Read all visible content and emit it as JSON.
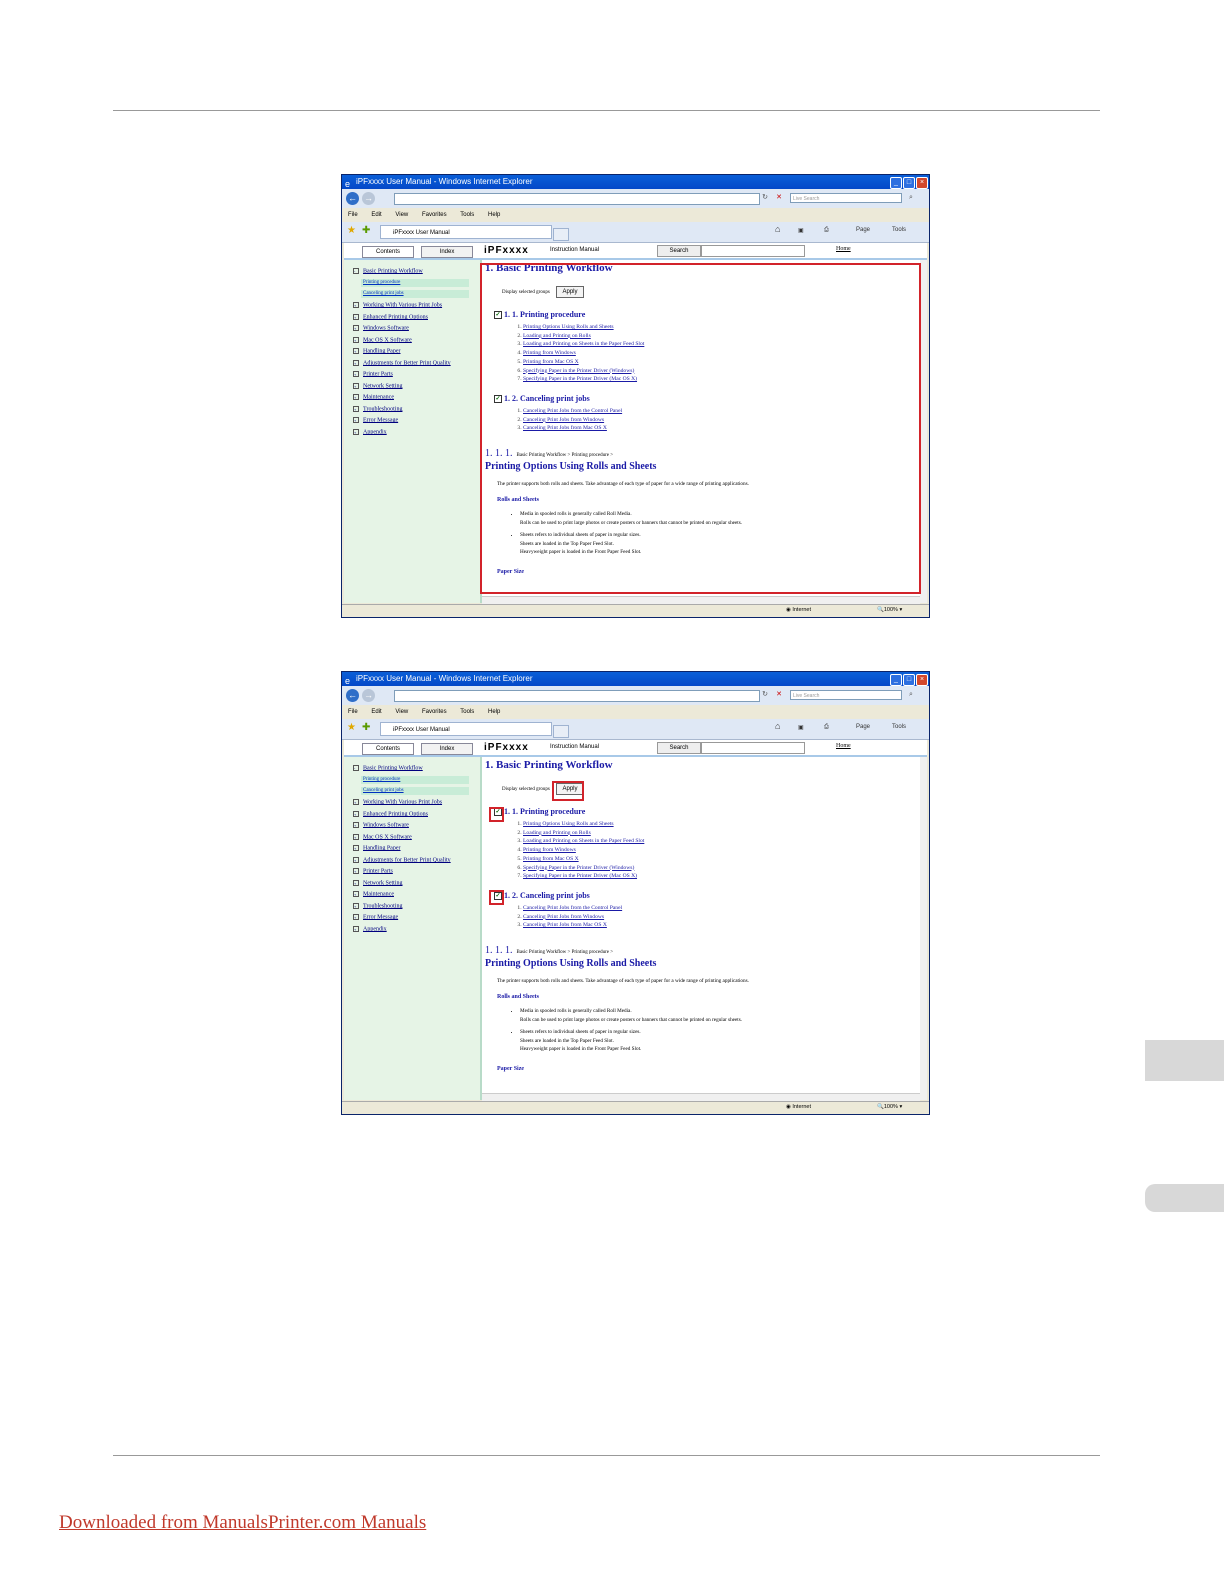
{
  "footer": {
    "link_text": "Downloaded from ManualsPrinter.com Manuals"
  },
  "screenshots": [
    {
      "window_title": "iPFxxxx User Manual - Windows Internet Explorer",
      "search_placeholder": "Live Search",
      "menu": [
        "File",
        "Edit",
        "View",
        "Favorites",
        "Tools",
        "Help"
      ],
      "tab_title": "iPFxxxx User Manual",
      "commands": {
        "page": "Page",
        "tools": "Tools"
      },
      "nav": {
        "contents": "Contents",
        "index": "Index",
        "brand": "iPFxxxx",
        "manual": "Instruction Manual",
        "search": "Search",
        "home": "Home"
      },
      "sidebar": {
        "items": [
          "Basic Printing Workflow",
          "Working With Various Print Jobs",
          "Enhanced Printing Options",
          "Windows Software",
          "Mac OS X Software",
          "Handling Paper",
          "Adjustments for Better Print Quality",
          "Printer Parts",
          "Network Setting",
          "Maintenance",
          "Troubleshooting",
          "Error Message",
          "Appendix"
        ],
        "subitems": [
          "Printing procedure",
          "Canceling print jobs"
        ]
      },
      "main": {
        "title": "1. Basic Printing Workflow",
        "display_selected": "Display selected groups",
        "apply": "Apply",
        "sec1": "1. 1. Printing procedure",
        "sec1_items": [
          "Printing Options Using Rolls and Sheets",
          "Loading and Printing on Rolls",
          "Loading and Printing on Sheets in the Paper Feed Slot",
          "Printing from Windows",
          "Printing from Mac OS X",
          "Specifying Paper in the Printer Driver (Windows)",
          "Specifying Paper in the Printer Driver (Mac OS X)"
        ],
        "sec2": "1. 2. Canceling print jobs",
        "sec2_items": [
          "Canceling Print Jobs from the Control Panel",
          "Canceling Print Jobs from Windows",
          "Canceling Print Jobs from Mac OS X"
        ],
        "crumb_num": "1. 1. 1.",
        "crumb_path": "Basic Printing Workflow > Printing procedure >",
        "h2": "Printing Options Using Rolls and Sheets",
        "intro": "The printer supports both rolls and sheets. Take advantage of each type of paper for a wide range of printing applications.",
        "rolls_sheets": "Rolls and Sheets",
        "bullet1a": "Media in spooled rolls is generally called Roll Media.",
        "bullet1b": "Rolls can be used to print large photos or create posters or banners that cannot be printed on regular sheets.",
        "bullet2a": "Sheets refers to individual sheets of paper in regular sizes.",
        "bullet2b": "Sheets are loaded in the Top Paper Feed Slot.",
        "bullet2c": "Heavyweight paper is loaded in the Front Paper Feed Slot.",
        "paper_size": "Paper Size"
      },
      "status": {
        "zone": "Internet",
        "zoom": "100%"
      }
    }
  ]
}
